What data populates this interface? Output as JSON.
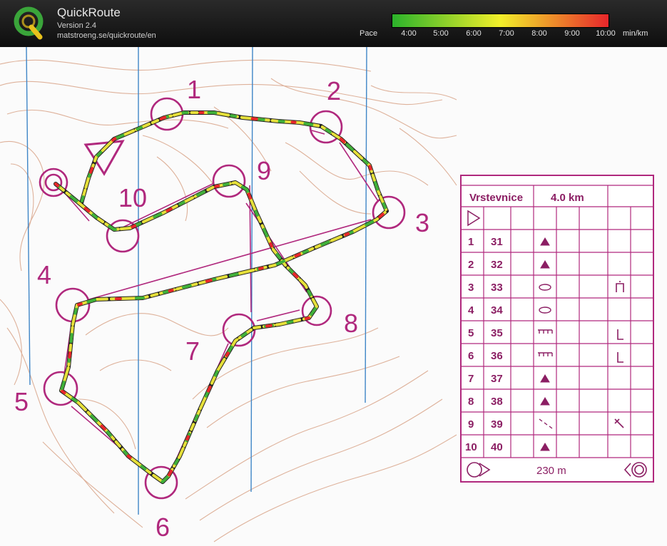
{
  "app": {
    "title": "QuickRoute",
    "version": "Version 2.4",
    "url": "matstroeng.se/quickroute/en"
  },
  "legend": {
    "label": "Pace",
    "ticks": [
      "4:00",
      "5:00",
      "6:00",
      "7:00",
      "8:00",
      "9:00",
      "10:00"
    ],
    "unit": "min/km",
    "colors": {
      "fast": "#2bb32b",
      "mid": "#f2ef2a",
      "slow": "#e8262b"
    }
  },
  "map": {
    "controls": [
      "1",
      "2",
      "3",
      "4",
      "5",
      "6",
      "7",
      "8",
      "9",
      "10"
    ],
    "course": {
      "name": "Vrstevnice",
      "length": "4.0 km",
      "finish_distance": "230 m",
      "rows": [
        {
          "num": "1",
          "code": "31"
        },
        {
          "num": "2",
          "code": "32"
        },
        {
          "num": "3",
          "code": "33"
        },
        {
          "num": "4",
          "code": "34"
        },
        {
          "num": "5",
          "code": "35"
        },
        {
          "num": "6",
          "code": "36"
        },
        {
          "num": "7",
          "code": "37"
        },
        {
          "num": "8",
          "code": "38"
        },
        {
          "num": "9",
          "code": "39"
        },
        {
          "num": "10",
          "code": "40"
        }
      ]
    }
  }
}
